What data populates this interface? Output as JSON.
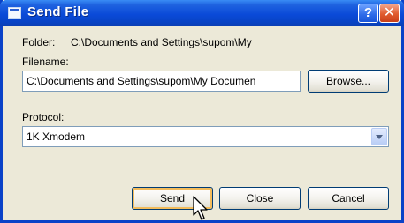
{
  "window": {
    "title": "Send File",
    "help_symbol": "?",
    "close_symbol": "✕"
  },
  "folder": {
    "label": "Folder:",
    "value": "C:\\Documents and Settings\\supom\\My"
  },
  "filename": {
    "label": "Filename:",
    "value": "C:\\Documents and Settings\\supom\\My Documen"
  },
  "browse_label": "Browse...",
  "protocol": {
    "label": "Protocol:",
    "selected": "1K Xmodem"
  },
  "buttons": {
    "send": "Send",
    "close": "Close",
    "cancel": "Cancel"
  },
  "icons": [
    "window-icon",
    "help-icon",
    "close-icon",
    "dropdown-arrow-icon",
    "mouse-pointer-icon"
  ]
}
